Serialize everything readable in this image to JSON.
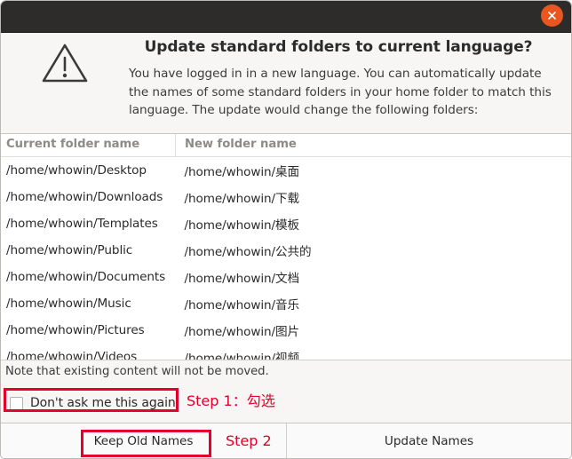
{
  "window": {
    "titlebar": {
      "close_label": "close-window"
    }
  },
  "message": {
    "icon": "warning-triangle-icon",
    "title": "Update standard folders to current language?",
    "body": "You have logged in in a new language. You can automatically update the names of some standard folders in your home folder to match this language. The update would change the following folders:"
  },
  "table": {
    "headers": [
      "Current folder name",
      "New folder name"
    ],
    "rows": [
      {
        "current": "/home/whowin/Desktop",
        "updated": "/home/whowin/桌面"
      },
      {
        "current": "/home/whowin/Downloads",
        "updated": "/home/whowin/下载"
      },
      {
        "current": "/home/whowin/Templates",
        "updated": "/home/whowin/模板"
      },
      {
        "current": "/home/whowin/Public",
        "updated": "/home/whowin/公共的"
      },
      {
        "current": "/home/whowin/Documents",
        "updated": "/home/whowin/文档"
      },
      {
        "current": "/home/whowin/Music",
        "updated": "/home/whowin/音乐"
      },
      {
        "current": "/home/whowin/Pictures",
        "updated": "/home/whowin/图片"
      },
      {
        "current": "/home/whowin/Videos",
        "updated": "/home/whowin/视频"
      }
    ]
  },
  "note": {
    "text": "Note that existing content will not be moved.",
    "checkbox_label": "Don't ask me this again",
    "checkbox_checked": false
  },
  "buttons": {
    "keep_old": "Keep Old Names",
    "update": "Update Names"
  },
  "annotations": {
    "step1": "Step 1：勾选",
    "step2": "Step 2",
    "color": "#e4002b"
  }
}
